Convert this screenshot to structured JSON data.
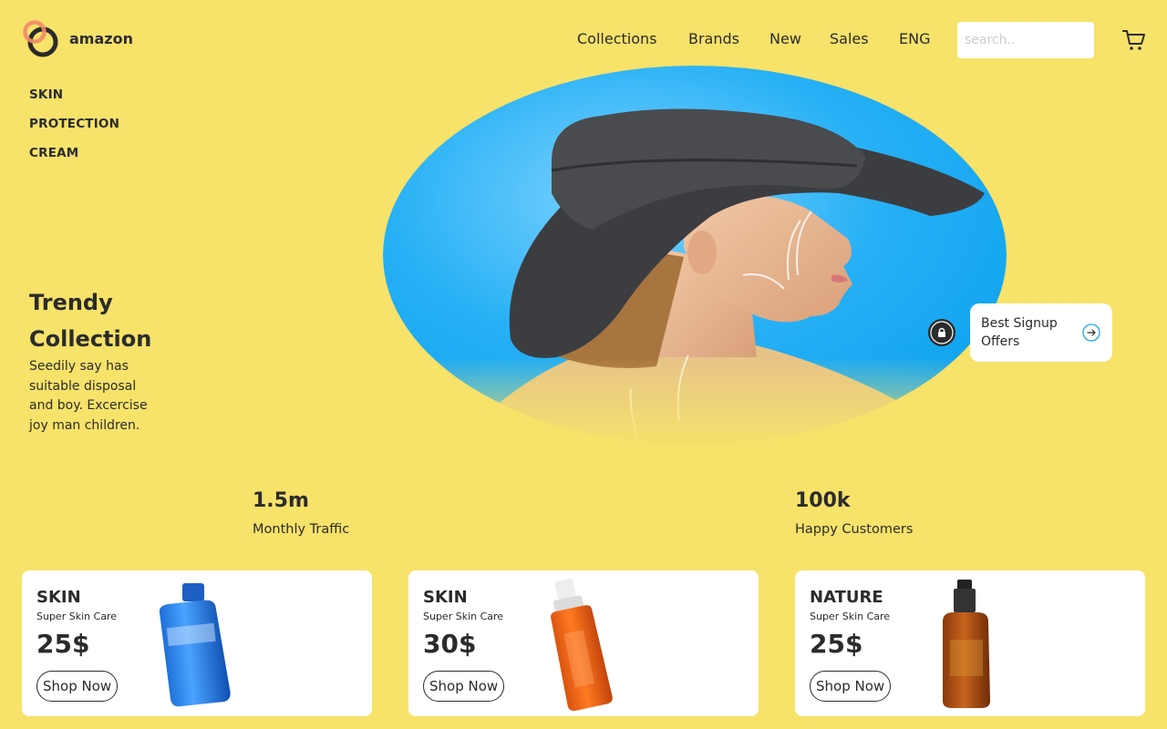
{
  "header": {
    "brand": "amazon",
    "nav": [
      "Collections",
      "Brands",
      "New",
      "Sales",
      "ENG"
    ],
    "search_placeholder": "search.."
  },
  "side_menu": [
    "SKIN",
    "PROTECTION",
    "CREAM"
  ],
  "hero": {
    "title_line1": "Trendy",
    "title_line2": "Collection",
    "description": "Seedily say has suitable disposal and boy. Excercise joy man children."
  },
  "signup": {
    "label": "Best Signup Offers"
  },
  "stats": [
    {
      "value": "1.5m",
      "label": "Monthly Traffic"
    },
    {
      "value": "100k",
      "label": "Happy Customers"
    }
  ],
  "cards": [
    {
      "category": "SKIN",
      "subtitle": "Super Skin Care",
      "price": "25$",
      "button": "Shop Now",
      "product": "blue-bottle"
    },
    {
      "category": "SKIN",
      "subtitle": "Super Skin Care",
      "price": "30$",
      "button": "Shop Now",
      "product": "orange-bottle"
    },
    {
      "category": "NATURE",
      "subtitle": "Super Skin Care",
      "price": "25$",
      "button": "Shop Now",
      "product": "amber-spray"
    }
  ],
  "colors": {
    "background": "#f7e26a",
    "hero_blue": "#1aa9f0",
    "text": "#2b2b2b",
    "logo_accent": "#f08a6a"
  }
}
